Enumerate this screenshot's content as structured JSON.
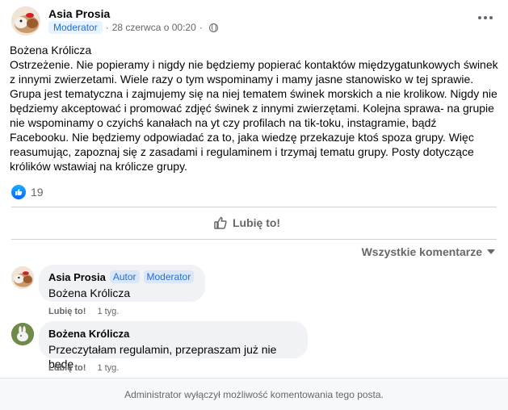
{
  "post": {
    "author": "Asia Prosia",
    "role_badge": "Moderator",
    "separator": "·",
    "timestamp": "28 czerwca o 00:20",
    "privacy_icon": "globe-icon",
    "title": "Bożena Królicza",
    "text": "Ostrzeżenie. Nie popieramy i nigdy nie będziemy popierać kontaktów międzygatunkowych świnek z innymi zwierzetami. Wiele razy o tym wspominamy i mamy jasne stanowisko w tej sprawie. Grupa jest tematyczna i zajmujemy się na niej tematem świnek morskich a nie krolikow. Nigdy nie będziemy akceptować i promować zdjęć świnek z innymi zwierzętami. Kolejna sprawa- na grupie nie wspominamy o czyichś kanałach na yt czy profilach na tik-toku, instagramie, bądź Facebooku. Nie będziemy odpowiadać za to, jaka wiedzę przekazuje ktoś spoza grupy. Więc reasumując, zapoznaj się z zasadami i regulaminem i trzymaj tematu grupy. Posty dotyczące królików wstawiaj na królicze grupy."
  },
  "reactions": {
    "count": "19",
    "icon": "like-icon"
  },
  "actions": {
    "like_label": "Lubię to!"
  },
  "comments_sort": {
    "label": "Wszystkie komentarze"
  },
  "comments": [
    {
      "author": "Asia Prosia",
      "badges": [
        "Autor",
        "Moderator"
      ],
      "text": "Bożena Królicza",
      "like_label": "Lubię to!",
      "time": "1 tyg."
    },
    {
      "author": "Bożena Królicza",
      "badges": [],
      "text": "Przeczytałam regulamin, przepraszam już nie będę",
      "like_label": "Lubię to!",
      "time": "1 tyg."
    }
  ],
  "footer": {
    "text": "Administrator wyłączył możliwość komentowania tego posta."
  },
  "colors": {
    "accent": "#0866ff",
    "badge_bg": "#e7f3ff",
    "badge_text": "#216fdb",
    "muted": "#65676b",
    "bubble": "#f0f2f5"
  }
}
